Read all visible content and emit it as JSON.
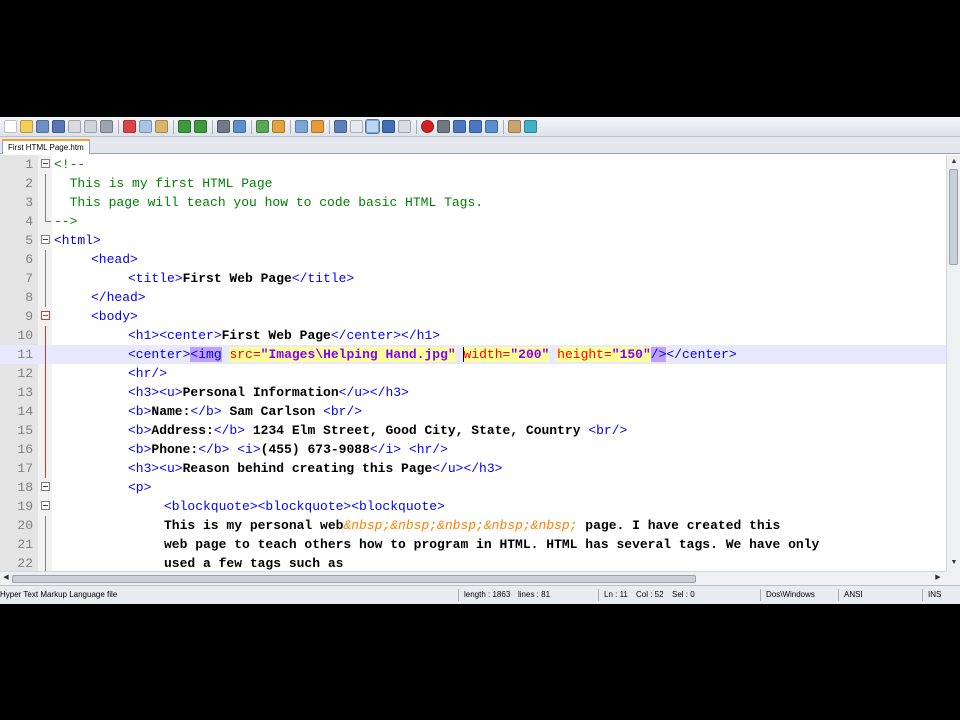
{
  "tab": {
    "label": "First HTML Page.htm"
  },
  "toolbar": {
    "icons": [
      "new-file",
      "open-file",
      "save",
      "save-all",
      "close",
      "close-all",
      "print",
      "cut",
      "copy",
      "paste",
      "undo",
      "redo",
      "find",
      "replace",
      "zoom-in",
      "zoom-out",
      "sync-vertical",
      "sync-horizontal",
      "word-wrap",
      "show-all-chars",
      "indent-guide",
      "user-language",
      "doc-map",
      "record-macro",
      "stop-macro",
      "play-macro",
      "run-macro-multiple",
      "save-macro",
      "spellcheck",
      "function-list"
    ]
  },
  "editor": {
    "current_line": 11,
    "lines": [
      {
        "n": "1"
      },
      {
        "n": "2"
      },
      {
        "n": "3"
      },
      {
        "n": "4"
      },
      {
        "n": "5"
      },
      {
        "n": "6"
      },
      {
        "n": "7"
      },
      {
        "n": "8"
      },
      {
        "n": "9"
      },
      {
        "n": "10"
      },
      {
        "n": "11"
      },
      {
        "n": "12"
      },
      {
        "n": "13"
      },
      {
        "n": "14"
      },
      {
        "n": "15"
      },
      {
        "n": "16"
      },
      {
        "n": "17"
      },
      {
        "n": "18"
      },
      {
        "n": "19"
      },
      {
        "n": "20"
      },
      {
        "n": "21"
      },
      {
        "n": "22"
      }
    ],
    "code": {
      "l1": "<!--",
      "l2": "  This is my first HTML Page",
      "l3": "  This page will teach you how to code basic HTML Tags.",
      "l4": "-->",
      "l5": "<html>",
      "l6_tag": "<head>",
      "l7_open": "<title>",
      "l7_text": "First Web Page",
      "l7_close": "</title>",
      "l8": "</head>",
      "l9": "<body>",
      "l10_open": "<h1><center>",
      "l10_text": "First Web Page",
      "l10_close": "</center></h1>",
      "l11_center": "<center>",
      "l11_img": "<img",
      "l11_src_attr": "src=",
      "l11_src_val": "\"Images\\Helping Hand.jpg\"",
      "l11_width_attr": "width=",
      "l11_width_val": "\"200\"",
      "l11_height_attr": "height=",
      "l11_height_val": "\"150\"",
      "l11_end": "/>",
      "l11_close": "</center>",
      "l12": "<hr/>",
      "l13_open": "<h3><u>",
      "l13_text": "Personal Information",
      "l13_close": "</u></h3>",
      "l14_b": "<b>",
      "l14_label": "Name:",
      "l14_eb": "</b>",
      "l14_text": " Sam Carlson ",
      "l14_br": "<br/>",
      "l15_b": "<b>",
      "l15_label": "Address:",
      "l15_eb": "</b>",
      "l15_text": " 1234 Elm Street, Good City, State, Country ",
      "l15_br": "<br/>",
      "l16_b": "<b>",
      "l16_label": "Phone:",
      "l16_eb": "</b>",
      "l16_i": "<i>",
      "l16_text": "(455) 673-9088",
      "l16_ei": "</i>",
      "l16_hr": "<hr/>",
      "l17_open": "<h3><u>",
      "l17_text": "Reason behind creating this Page",
      "l17_close": "</u></h3>",
      "l18": "<p>",
      "l19": "<blockquote><blockquote><blockquote>",
      "l20_text": "This is my personal web",
      "l20_ent": "&nbsp;&nbsp;&nbsp;&nbsp;&nbsp;",
      "l20_rest": " page. I have created this",
      "l21": "web page to teach others how to program in HTML. HTML has several tags. We have only",
      "l22": "used a few tags such as"
    }
  },
  "status": {
    "file_type": "Hyper Text Markup Language file",
    "length": "length : 1863",
    "lines": "lines : 81",
    "ln": "Ln : 11",
    "col": "Col : 52",
    "sel": "Sel : 0",
    "eol": "Dos\\Windows",
    "encoding": "ANSI",
    "mode": "INS"
  }
}
